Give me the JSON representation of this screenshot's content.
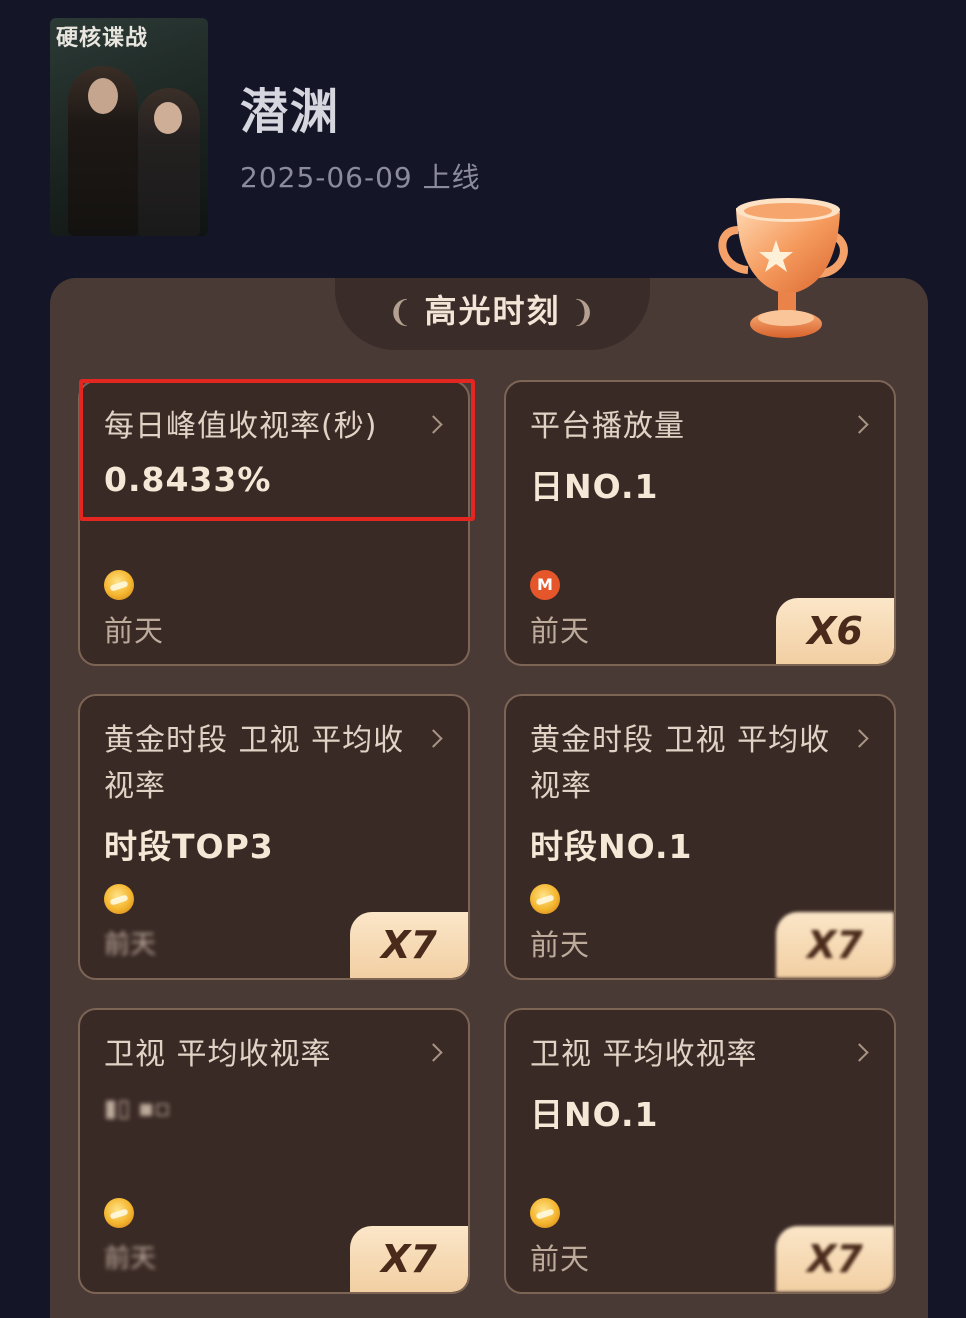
{
  "header": {
    "poster_title": "硬核谍战",
    "show_title": "潜渊",
    "release_date": "2025-06-09 上线"
  },
  "section": {
    "title": "高光时刻"
  },
  "cards": [
    {
      "label": "每日峰值收视率(秒)",
      "value": "0.8433%",
      "platform_icon": "mango-tv-logo",
      "time": "前天",
      "multiplier": "",
      "highlighted": true
    },
    {
      "label": "平台播放量",
      "value": "日NO.1",
      "platform_icon": "mgtv-app-logo",
      "time": "前天",
      "multiplier": "X6"
    },
    {
      "label": "黄金时段 卫视 平均收视率",
      "value": "时段TOP3",
      "platform_icon": "mango-tv-logo",
      "time": "前天",
      "multiplier": "X7"
    },
    {
      "label": "黄金时段 卫视 平均收视率",
      "value": "时段NO.1",
      "platform_icon": "mango-tv-logo",
      "time": "前天",
      "multiplier": "X7"
    },
    {
      "label": "卫视 平均收视率",
      "value": "",
      "platform_icon": "mango-tv-logo",
      "time": "前天",
      "multiplier": "X7"
    },
    {
      "label": "卫视 平均收视率",
      "value": "日NO.1",
      "platform_icon": "mango-tv-logo",
      "time": "前天",
      "multiplier": "X7"
    }
  ],
  "colors": {
    "background": "#151528",
    "panel": "#4a3a36",
    "card": "#3a2a26",
    "highlight_border": "#e3261f",
    "badge": "#f2cfa3"
  }
}
